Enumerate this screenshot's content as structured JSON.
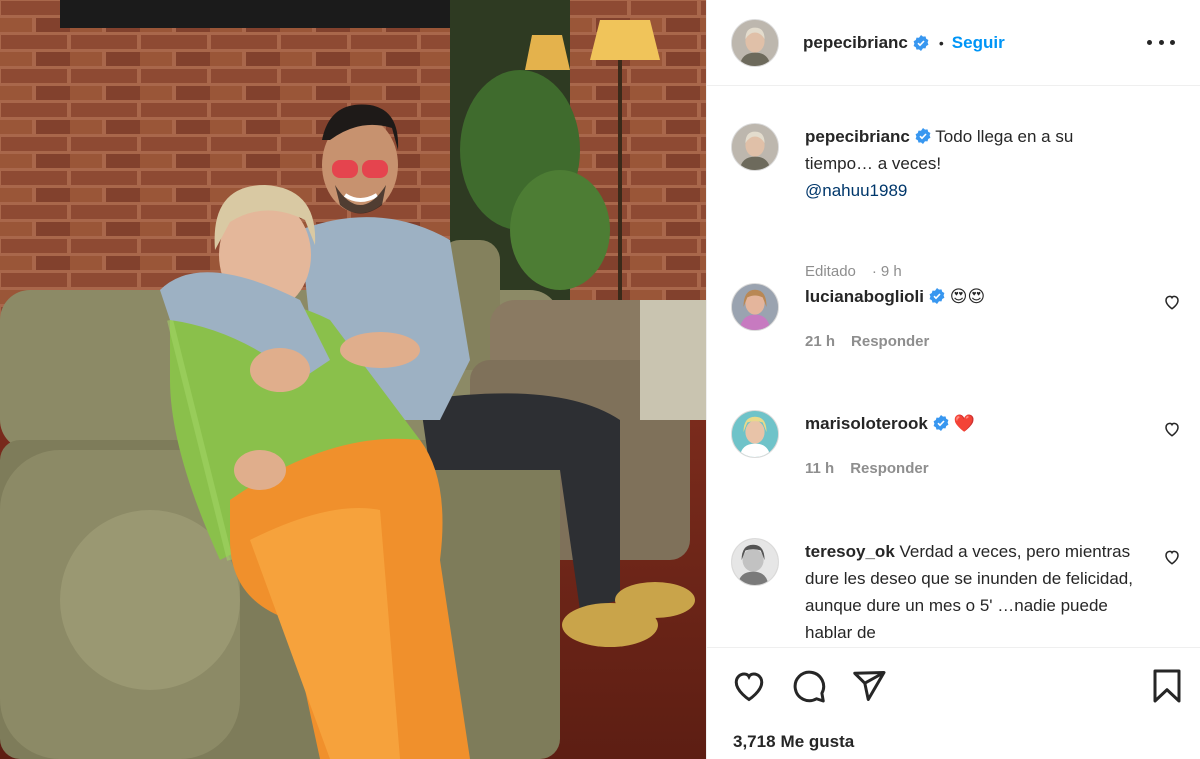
{
  "post": {
    "author": {
      "username": "pepecibrianc",
      "verified": true
    },
    "follow_label": "Seguir",
    "separator": "•",
    "caption": {
      "username": "pepecibrianc",
      "text": "Todo llega en a su tiempo… a veces!",
      "mention": "@nahuu1989",
      "edited_label": "Editado",
      "meta_sep": "·",
      "time": "9 h"
    },
    "comments": [
      {
        "username": "lucianaboglioli",
        "verified": true,
        "text": "😍😍",
        "time": "21 h",
        "reply_label": "Responder"
      },
      {
        "username": "marisoloterook",
        "verified": true,
        "text": "❤️",
        "time": "11 h",
        "reply_label": "Responder"
      },
      {
        "username": "teresoy_ok",
        "verified": false,
        "text": "Verdad a veces, pero mientras dure les deseo que se inunden de felicidad, aunque dure un mes o 5' …nadie puede hablar de"
      }
    ],
    "likes_count": "3,718",
    "likes_label": "Me gusta"
  },
  "colors": {
    "accent": "#0095f6",
    "verified": "#3897f0",
    "heart_red": "#ed4956",
    "meta_gray": "#8e8e8e"
  },
  "icons": [
    "verified-badge-icon",
    "more-options-icon",
    "heart-icon",
    "comment-icon",
    "share-icon",
    "bookmark-icon"
  ]
}
